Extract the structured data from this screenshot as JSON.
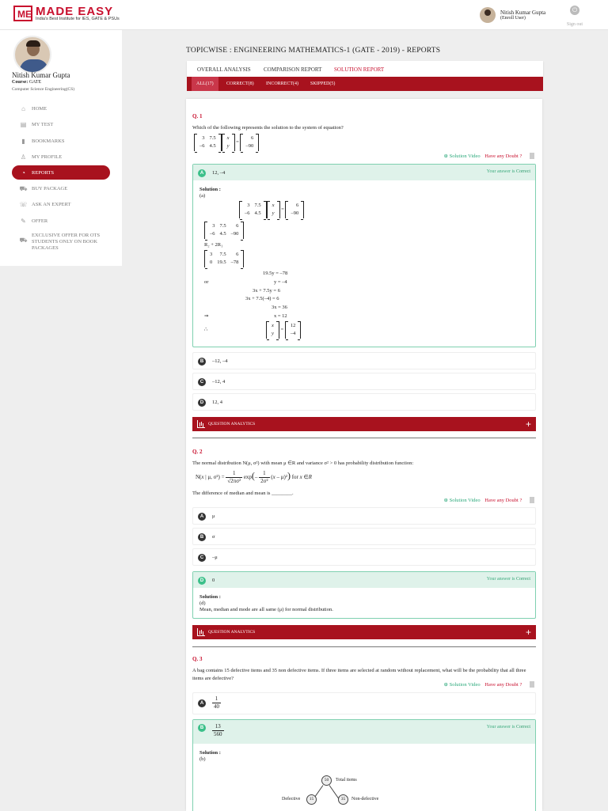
{
  "header": {
    "brand_mark": "ME",
    "brand_name": "MADE EASY",
    "brand_tagline": "India's Best Institute for IES, GATE & PSUs",
    "user_name": "Nitish Kumar Gupta",
    "user_role": "(Enroll User)",
    "signout_label": "Sign out"
  },
  "sidebar": {
    "name": "Nitish Kumar Gupta",
    "course_label": "Course:",
    "course": "GATE",
    "branch": "Computer Science Engineering(CS)",
    "items": [
      {
        "label": "HOME",
        "icon": "home-icon",
        "glyph": "⌂"
      },
      {
        "label": "MY TEST",
        "icon": "test-icon",
        "glyph": "▤"
      },
      {
        "label": "BOOKMARKS",
        "icon": "bookmark-icon",
        "glyph": "▮"
      },
      {
        "label": "MY PROFILE",
        "icon": "profile-icon",
        "glyph": "♙"
      },
      {
        "label": "REPORTS",
        "icon": "reports-icon",
        "glyph": "◔"
      },
      {
        "label": "BUY PACKAGE",
        "icon": "cart-icon",
        "glyph": "⛟"
      },
      {
        "label": "ASK AN EXPERT",
        "icon": "expert-icon",
        "glyph": "☏"
      },
      {
        "label": "OFFER",
        "icon": "offer-icon",
        "glyph": "✎"
      },
      {
        "label": "EXCLUSIVE OFFER FOR OTS STUDENTS ONLY ON BOOK PACKAGES",
        "icon": "exclusive-cart-icon",
        "glyph": "⛟"
      }
    ]
  },
  "main": {
    "title": "TOPICWISE : ENGINEERING MATHEMATICS-1 (GATE - 2019) - REPORTS",
    "report_tabs": [
      "OVERALL ANALYSIS",
      "COMPARISON REPORT",
      "SOLUTION REPORT"
    ],
    "filter_tabs": [
      "ALL(17)",
      "CORRECT(8)",
      "INCORRECT(4)",
      "SKIPPED(5)"
    ],
    "solution_video": "Solution Video",
    "doubt": "Have any Doubt ?",
    "answer_text": "Your answer is",
    "correct_word": "Correct",
    "solution_label": "Solution :",
    "analytics_label": "QUESTION ANALYTICS",
    "questions": [
      {
        "label": "Q. 1",
        "text": "Which of the following represents the solution to the system of equation?",
        "options": [
          "12, –4",
          "–12, –4",
          "–12, 4",
          "12, 4"
        ],
        "solution_key": "(a)",
        "op": "R₂ + 2R₁",
        "steps": [
          "19.5y = –78",
          "or          y = –4",
          "3x + 7.5y = 6",
          "3x + 7.5(–4) = 6",
          "3x = 36",
          "⇒          x = 12",
          "∴"
        ]
      },
      {
        "label": "Q. 2",
        "text": "The normal distribution N(μ, σ²) with mean μ ∈R and variance σ² > 0 has probability distribution function:",
        "text2": "The difference of median and mean is ________.",
        "options": [
          "μ",
          "σ",
          "–μ",
          "0"
        ],
        "solution_key": "(d)",
        "solution_text": "Mean, median and mode are all same (μ) for normal distribution."
      },
      {
        "label": "Q. 3",
        "text": "A bag contains 15 defective items and 35 non defective items. If three items are selected at random without replacement, what will be the probability that all three items are defective?",
        "options": [
          {
            "n": "1",
            "d": "40"
          },
          {
            "n": "13",
            "d": "560"
          }
        ],
        "solution_key": "(b)",
        "tree": {
          "total": "50",
          "total_label": "Total items",
          "def": "15",
          "def_label": "Defective",
          "nondef": "35",
          "nondef_label": "Non-defective"
        }
      }
    ],
    "option_letters": [
      "A",
      "B",
      "C",
      "D"
    ]
  },
  "colors": {
    "brand": "#c8102e",
    "bar": "#a8121e",
    "correct": "#3cc08a",
    "correct_bg": "#dff2ea"
  }
}
